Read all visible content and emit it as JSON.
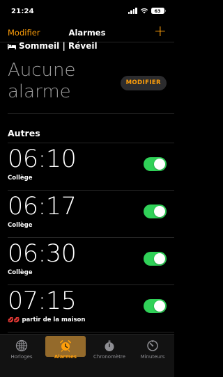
{
  "status_bar": {
    "time": "21:24",
    "battery": "63"
  },
  "nav": {
    "left": "Modifier",
    "title": "Alarmes",
    "add": "+"
  },
  "sleep": {
    "header": "Sommeil | Réveil",
    "no_alarm": "Aucune alarme",
    "button": "MODIFIER"
  },
  "others": {
    "title": "Autres",
    "alarms": [
      {
        "time": "06:10",
        "label": "Collège",
        "enabled": true
      },
      {
        "time": "06:17",
        "label": "Collège",
        "enabled": true
      },
      {
        "time": "06:30",
        "label": "Collège",
        "enabled": true
      },
      {
        "time": "07:15",
        "label": "partir de la maison",
        "emoji": "💋💋",
        "enabled": true
      }
    ]
  },
  "tabs": [
    {
      "label": "Horloges",
      "icon": "globe-icon",
      "active": false
    },
    {
      "label": "Alarmes",
      "icon": "alarm-clock-icon",
      "active": true
    },
    {
      "label": "Chronomètre",
      "icon": "stopwatch-icon",
      "active": false
    },
    {
      "label": "Minuteurs",
      "icon": "timer-icon",
      "active": false
    }
  ],
  "colors": {
    "accent": "#ff9f0a",
    "toggle_on": "#30d158",
    "secondary_text": "#9b9b9b"
  }
}
